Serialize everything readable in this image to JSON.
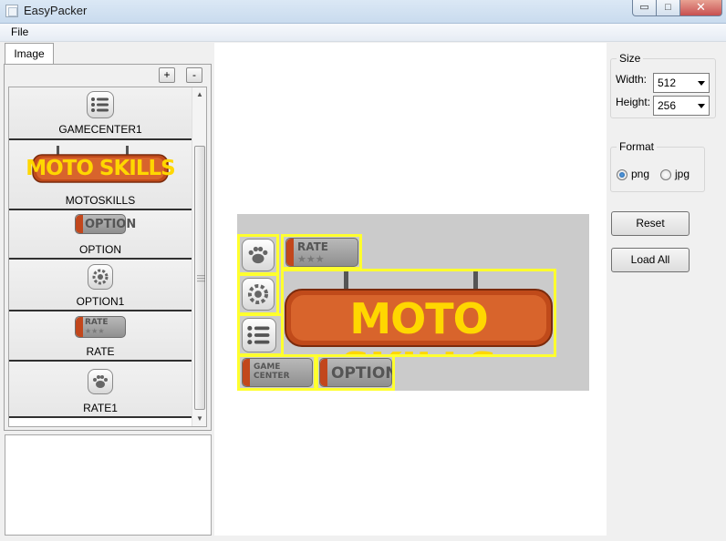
{
  "window": {
    "title": "EasyPacker",
    "controls": {
      "minimize": "▭",
      "maximize": "□",
      "close": "✕"
    }
  },
  "menu": {
    "file": "File"
  },
  "left": {
    "tab": "Image",
    "add_label": "+",
    "remove_label": "-",
    "items": [
      {
        "label": "GAMECENTER1",
        "art": "list-icon"
      },
      {
        "label": "MOTOSKILLS",
        "art": "moto-skills-sign",
        "text": "MOTO SKILLS"
      },
      {
        "label": "OPTION",
        "art": "option-plate",
        "text": "OPTION"
      },
      {
        "label": "OPTION1",
        "art": "gear-icon"
      },
      {
        "label": "RATE",
        "art": "rate-plate",
        "text": "RATE"
      },
      {
        "label": "RATE1",
        "art": "paw-icon"
      }
    ]
  },
  "atlas": {
    "sprites": [
      {
        "name": "RATE1",
        "art": "paw-icon"
      },
      {
        "name": "OPTION1",
        "art": "gear-icon"
      },
      {
        "name": "GAMECENTER1",
        "art": "list-icon"
      },
      {
        "name": "RATE",
        "art": "rate-plate",
        "text": "RATE"
      },
      {
        "name": "MOTOSKILLS",
        "art": "moto-skills-sign",
        "text": "MOTO SKILLS"
      },
      {
        "name": "GAMECENTER",
        "art": "game-center-plate",
        "text": "GAME CENTER"
      },
      {
        "name": "OPTION",
        "art": "option-plate",
        "text": "OPTION"
      }
    ],
    "background_color": "#cbcbcb",
    "outline_color": "#ffff2e"
  },
  "size": {
    "title": "Size",
    "width_label": "Width:",
    "width_value": "512",
    "height_label": "Height:",
    "height_value": "256"
  },
  "format": {
    "title": "Format",
    "options": [
      "png",
      "jpg"
    ],
    "selected": "png"
  },
  "buttons": {
    "reset": "Reset",
    "load_all": "Load All"
  }
}
